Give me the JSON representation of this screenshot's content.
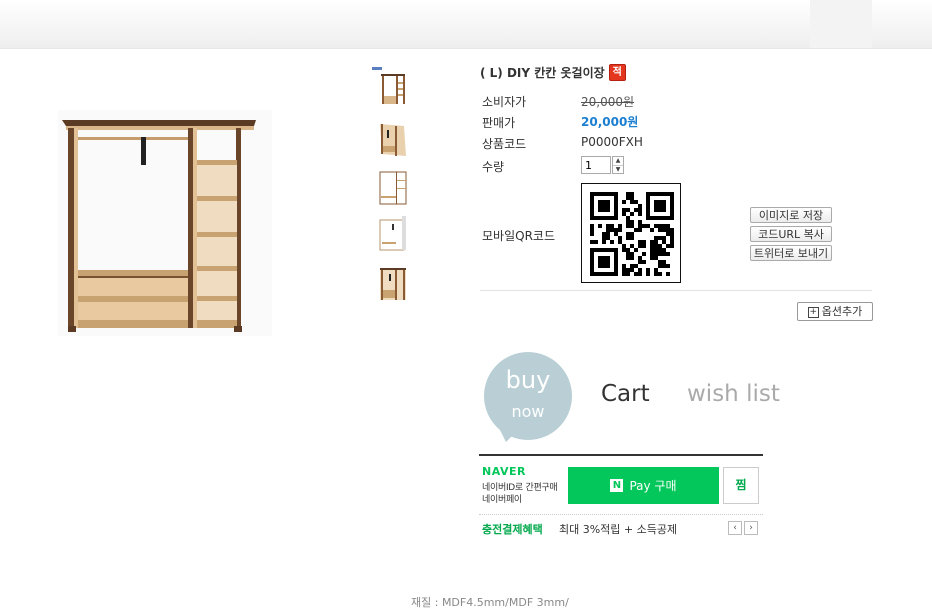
{
  "product": {
    "title": "( L) DIY 칸칸 옷걸이장",
    "badge": "적",
    "rows": {
      "consumer_price_label": "소비자가",
      "consumer_price": "20,000원",
      "sale_price_label": "판매가",
      "sale_price": "20,000원",
      "code_label": "상품코드",
      "code": "P0000FXH",
      "qty_label": "수량",
      "qty_value": "1",
      "qr_label": "모바일QR코드"
    }
  },
  "share_buttons": {
    "save_image": "이미지로 저장",
    "copy_url": "코드URL 복사",
    "twitter": "트위터로 보내기"
  },
  "option_add": "옵션추가",
  "actions": {
    "buy": "buy",
    "now": "now",
    "cart": "Cart",
    "wish": "wish list"
  },
  "naver": {
    "logo": "NAVER",
    "line1": "네이버ID로 간편구매",
    "line2": "네이버페이",
    "pay_n": "N",
    "pay_label": "Pay 구매",
    "jjim": "찜",
    "benefit_label": "충전결제혜택",
    "benefit_text": "최대 3%적립 + 소득공제"
  },
  "material": "재질 :   MDF4.5mm/MDF 3mm/",
  "colors": {
    "sale_price": "#1b7fd1",
    "naver_green": "#03c75a",
    "buy_bubble": "#b9cfd5"
  }
}
